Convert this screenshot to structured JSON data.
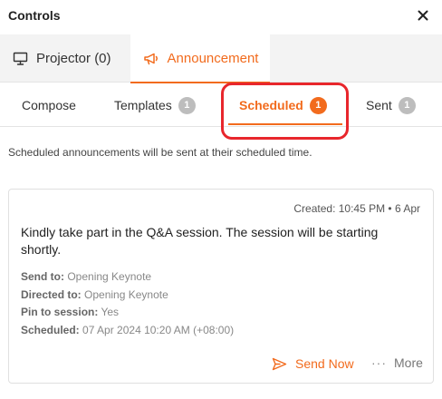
{
  "header": {
    "title": "Controls",
    "close_icon": "close-icon"
  },
  "main_tabs": {
    "projector": {
      "label": "Projector (0)",
      "icon": "monitor-icon"
    },
    "announcement": {
      "label": "Announcement",
      "icon": "megaphone-icon",
      "active": true
    }
  },
  "sub_tabs": {
    "compose": {
      "label": "Compose"
    },
    "templates": {
      "label": "Templates",
      "count": "1"
    },
    "scheduled": {
      "label": "Scheduled",
      "count": "1",
      "active": true
    },
    "sent": {
      "label": "Sent",
      "count": "1"
    }
  },
  "info_text": "Scheduled announcements will be sent at their scheduled time.",
  "announcement": {
    "created": "Created: 10:45 PM • 6 Apr",
    "message": "Kindly take part in the Q&A session. The session will be starting shortly.",
    "fields": [
      {
        "key": "Send to:",
        "value": "Opening Keynote"
      },
      {
        "key": "Directed to:",
        "value": "Opening Keynote"
      },
      {
        "key": "Pin to session:",
        "value": "Yes"
      },
      {
        "key": "Scheduled:",
        "value": "07 Apr 2024 10:20 AM (+08:00)"
      }
    ],
    "send_now_label": "Send Now",
    "more_label": "More"
  },
  "colors": {
    "accent": "#f26b1d",
    "highlight": "#e8262c",
    "badge_gray": "#bdbdbd"
  }
}
